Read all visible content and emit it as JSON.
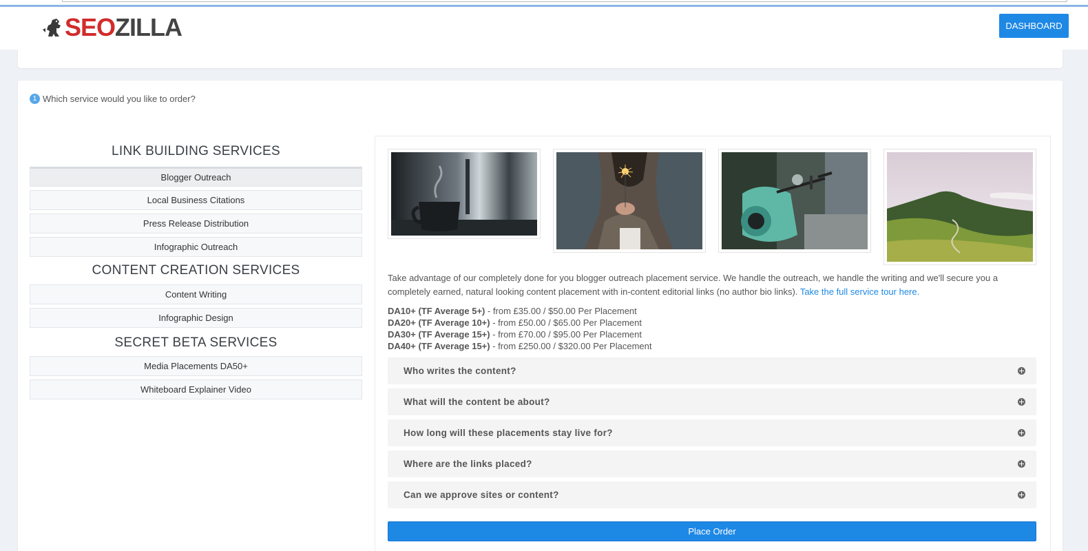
{
  "header": {
    "logo_text_1": "SEO",
    "logo_text_2": "ZILLA",
    "dashboard_label": "DASHBOARD"
  },
  "step": {
    "number": "1",
    "question": "Which service would you like to order?"
  },
  "sections": [
    {
      "title": "LINK BUILDING SERVICES",
      "items": [
        "Blogger Outreach",
        "Local Business Citations",
        "Press Release Distribution",
        "Infographic Outreach"
      ]
    },
    {
      "title": "CONTENT CREATION SERVICES",
      "items": [
        "Content Writing",
        "Infographic Design"
      ]
    },
    {
      "title": "SECRET BETA SERVICES",
      "items": [
        "Media Placements DA50+",
        "Whiteboard Explainer Video"
      ]
    }
  ],
  "selected_service": "Blogger Outreach",
  "detail": {
    "images": [
      "coffee-cup-photo",
      "sparkler-photo",
      "scooter-photo",
      "hills-photo"
    ],
    "description": "Take advantage of our completely done for you blogger outreach placement service. We handle the outreach, we handle the writing and we'll secure you a completely earned, natural looking content placement with in-content editorial links (no author bio links). ",
    "tour_link": "Take the full service tour here.",
    "prices": [
      {
        "tier": "DA10+ (TF Average 5+)",
        "text": " - from £35.00 / $50.00 Per Placement"
      },
      {
        "tier": "DA20+ (TF Average 10+)",
        "text": " - from £50.00 / $65.00 Per Placement"
      },
      {
        "tier": "DA30+ (TF Average 15+)",
        "text": " - from £70.00 / $95.00 Per Placement"
      },
      {
        "tier": "DA40+ (TF Average 15+)",
        "text": " - from £250.00 / $320.00 Per Placement"
      }
    ],
    "faqs": [
      "Who writes the content?",
      "What will the content be about?",
      "How long will these placements stay live for?",
      "Where are the links placed?",
      "Can we approve sites or content?"
    ],
    "order_label": "Place Order"
  },
  "colors": {
    "accent": "#1e88e5",
    "logo_red": "#d22b2b",
    "background": "#eef1f5"
  }
}
